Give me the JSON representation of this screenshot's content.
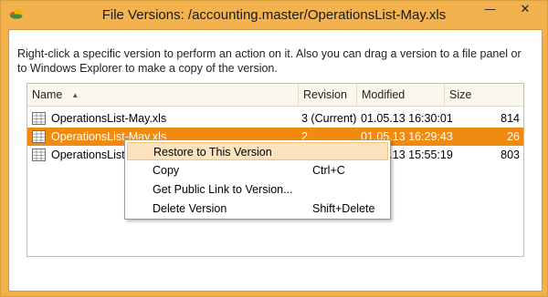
{
  "window": {
    "title": "File Versions: /accounting.master/OperationsList-May.xls",
    "minimize_glyph": "—",
    "close_glyph": "✕",
    "app_icon": "cloud-icon"
  },
  "description": "Right-click a specific version to perform an action on it. Also you can drag a version to a file panel or to Windows Explorer to make a copy of the version.",
  "columns": {
    "name": "Name",
    "revision": "Revision",
    "modified": "Modified",
    "size": "Size"
  },
  "rows": [
    {
      "name": "OperationsList-May.xls",
      "revision": "3 (Current)",
      "modified": "01.05.13 16:30:01",
      "size": "814",
      "selected": false
    },
    {
      "name": "OperationsList-May.xls",
      "revision": "2",
      "modified": "01.05.13 16:29:43",
      "size": "26",
      "selected": true
    },
    {
      "name": "OperationsList-",
      "revision": "",
      "modified": "01.05.13 15:55:19",
      "size": "803",
      "selected": false
    }
  ],
  "context_menu": {
    "items": [
      {
        "label": "Restore to This Version",
        "shortcut": ""
      },
      {
        "label": "Copy",
        "shortcut": "Ctrl+C"
      },
      {
        "label": "Get Public Link to Version...",
        "shortcut": ""
      },
      {
        "label": "Delete Version",
        "shortcut": "Shift+Delete"
      }
    ]
  },
  "colors": {
    "accent_titlebar": "#f3b24e",
    "selection": "#f08a11",
    "menu_highlight": "#fce3bd"
  }
}
